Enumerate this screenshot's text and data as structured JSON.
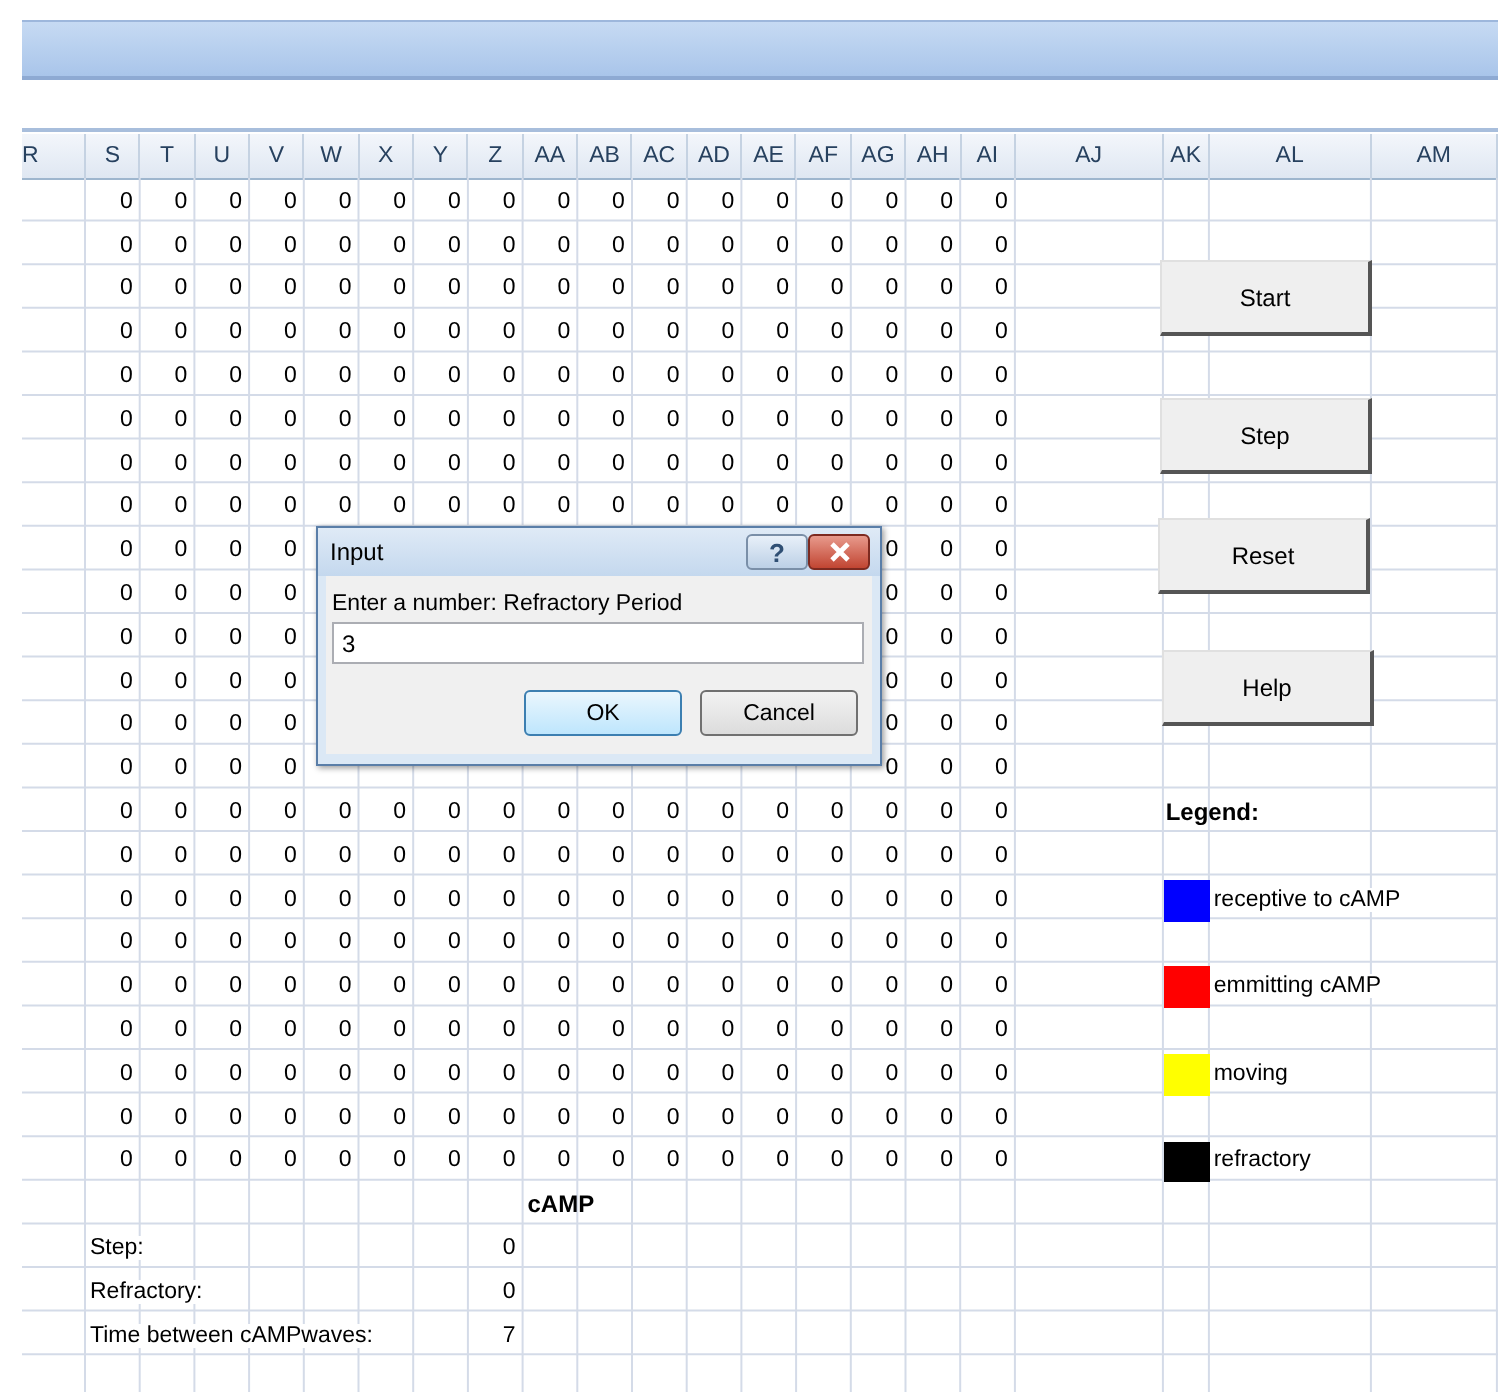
{
  "columns": [
    "R",
    "S",
    "T",
    "U",
    "V",
    "W",
    "X",
    "Y",
    "Z",
    "AA",
    "AB",
    "AC",
    "AD",
    "AE",
    "AF",
    "AG",
    "AH",
    "AI",
    "AJ",
    "AK",
    "AL",
    "AM"
  ],
  "rows": [
    {
      "cells": [
        "0",
        "0",
        "0",
        "0",
        "0",
        "0",
        "0",
        "0",
        "0",
        "0",
        "0",
        "0",
        "0",
        "0",
        "0",
        "0",
        "0"
      ]
    },
    {
      "cells": [
        "0",
        "0",
        "0",
        "0",
        "0",
        "0",
        "0",
        "0",
        "0",
        "0",
        "0",
        "0",
        "0",
        "0",
        "0",
        "0",
        "0"
      ]
    },
    {
      "cells": [
        "0",
        "0",
        "0",
        "0",
        "0",
        "0",
        "0",
        "0",
        "0",
        "0",
        "0",
        "0",
        "0",
        "0",
        "0",
        "0",
        "0"
      ]
    },
    {
      "cells": [
        "0",
        "0",
        "0",
        "0",
        "0",
        "0",
        "0",
        "0",
        "0",
        "0",
        "0",
        "0",
        "0",
        "0",
        "0",
        "0",
        "0"
      ]
    },
    {
      "cells": [
        "0",
        "0",
        "0",
        "0",
        "0",
        "0",
        "0",
        "0",
        "0",
        "0",
        "0",
        "0",
        "0",
        "0",
        "0",
        "0",
        "0"
      ]
    },
    {
      "cells": [
        "0",
        "0",
        "0",
        "0",
        "0",
        "0",
        "0",
        "0",
        "0",
        "0",
        "0",
        "0",
        "0",
        "0",
        "0",
        "0",
        "0"
      ]
    },
    {
      "cells": [
        "0",
        "0",
        "0",
        "0",
        "0",
        "0",
        "0",
        "0",
        "0",
        "0",
        "0",
        "0",
        "0",
        "0",
        "0",
        "0",
        "0"
      ]
    },
    {
      "cells": [
        "0",
        "0",
        "0",
        "0",
        "0",
        "0",
        "0",
        "0",
        "0",
        "0",
        "0",
        "0",
        "0",
        "0",
        "0",
        "0",
        "0"
      ]
    },
    {
      "cells_before": [
        "0",
        "0",
        "0",
        "0"
      ],
      "cells_after": [
        "0",
        "0",
        "0"
      ]
    },
    {
      "cells_before": [
        "0",
        "0",
        "0",
        "0"
      ],
      "cells_after": [
        "0",
        "0",
        "0"
      ]
    },
    {
      "cells_before": [
        "0",
        "0",
        "0",
        "0"
      ],
      "cells_after": [
        "0",
        "0",
        "0"
      ]
    },
    {
      "cells_before": [
        "0",
        "0",
        "0",
        "0"
      ],
      "cells_after": [
        "0",
        "0",
        "0"
      ]
    },
    {
      "cells_before": [
        "0",
        "0",
        "0",
        "0"
      ],
      "cells_after": [
        "0",
        "0",
        "0"
      ]
    },
    {
      "cells_before": [
        "0",
        "0",
        "0",
        "0"
      ],
      "cells_after": [
        "0",
        "0",
        "0"
      ]
    },
    {
      "cells": [
        "0",
        "0",
        "0",
        "0",
        "0",
        "0",
        "0",
        "0",
        "0",
        "0",
        "0",
        "0",
        "0",
        "0",
        "0",
        "0",
        "0"
      ]
    },
    {
      "cells": [
        "0",
        "0",
        "0",
        "0",
        "0",
        "0",
        "0",
        "0",
        "0",
        "0",
        "0",
        "0",
        "0",
        "0",
        "0",
        "0",
        "0"
      ]
    },
    {
      "cells": [
        "0",
        "0",
        "0",
        "0",
        "0",
        "0",
        "0",
        "0",
        "0",
        "0",
        "0",
        "0",
        "0",
        "0",
        "0",
        "0",
        "0"
      ]
    },
    {
      "cells": [
        "0",
        "0",
        "0",
        "0",
        "0",
        "0",
        "0",
        "0",
        "0",
        "0",
        "0",
        "0",
        "0",
        "0",
        "0",
        "0",
        "0"
      ]
    },
    {
      "cells": [
        "0",
        "0",
        "0",
        "0",
        "0",
        "0",
        "0",
        "0",
        "0",
        "0",
        "0",
        "0",
        "0",
        "0",
        "0",
        "0",
        "0"
      ]
    },
    {
      "cells": [
        "0",
        "0",
        "0",
        "0",
        "0",
        "0",
        "0",
        "0",
        "0",
        "0",
        "0",
        "0",
        "0",
        "0",
        "0",
        "0",
        "0"
      ]
    },
    {
      "cells": [
        "0",
        "0",
        "0",
        "0",
        "0",
        "0",
        "0",
        "0",
        "0",
        "0",
        "0",
        "0",
        "0",
        "0",
        "0",
        "0",
        "0"
      ]
    },
    {
      "cells": [
        "0",
        "0",
        "0",
        "0",
        "0",
        "0",
        "0",
        "0",
        "0",
        "0",
        "0",
        "0",
        "0",
        "0",
        "0",
        "0",
        "0"
      ]
    },
    {
      "cells": [
        "0",
        "0",
        "0",
        "0",
        "0",
        "0",
        "0",
        "0",
        "0",
        "0",
        "0",
        "0",
        "0",
        "0",
        "0",
        "0",
        "0"
      ]
    }
  ],
  "summary": {
    "title": "cAMP",
    "stats": [
      {
        "label": "Step:",
        "value": "0"
      },
      {
        "label": "Refractory:",
        "value": "0"
      },
      {
        "label": "Time between cAMPwaves:",
        "value": "7"
      }
    ]
  },
  "buttons": [
    "Start",
    "Step",
    "Reset",
    "Help"
  ],
  "legend": {
    "title": "Legend:",
    "items": [
      {
        "label": "receptive to cAMP",
        "color": "#0000ff"
      },
      {
        "label": "emmitting cAMP",
        "color": "#ff0000"
      },
      {
        "label": "moving",
        "color": "#ffff00"
      },
      {
        "label": "refractory",
        "color": "#000000"
      }
    ]
  },
  "dialog": {
    "title": "Input",
    "help": "?",
    "prompt": "Enter a number: Refractory Period",
    "value": "3",
    "buttons": [
      {
        "label": "OK",
        "default": true
      },
      {
        "label": "Cancel",
        "default": false
      }
    ]
  }
}
